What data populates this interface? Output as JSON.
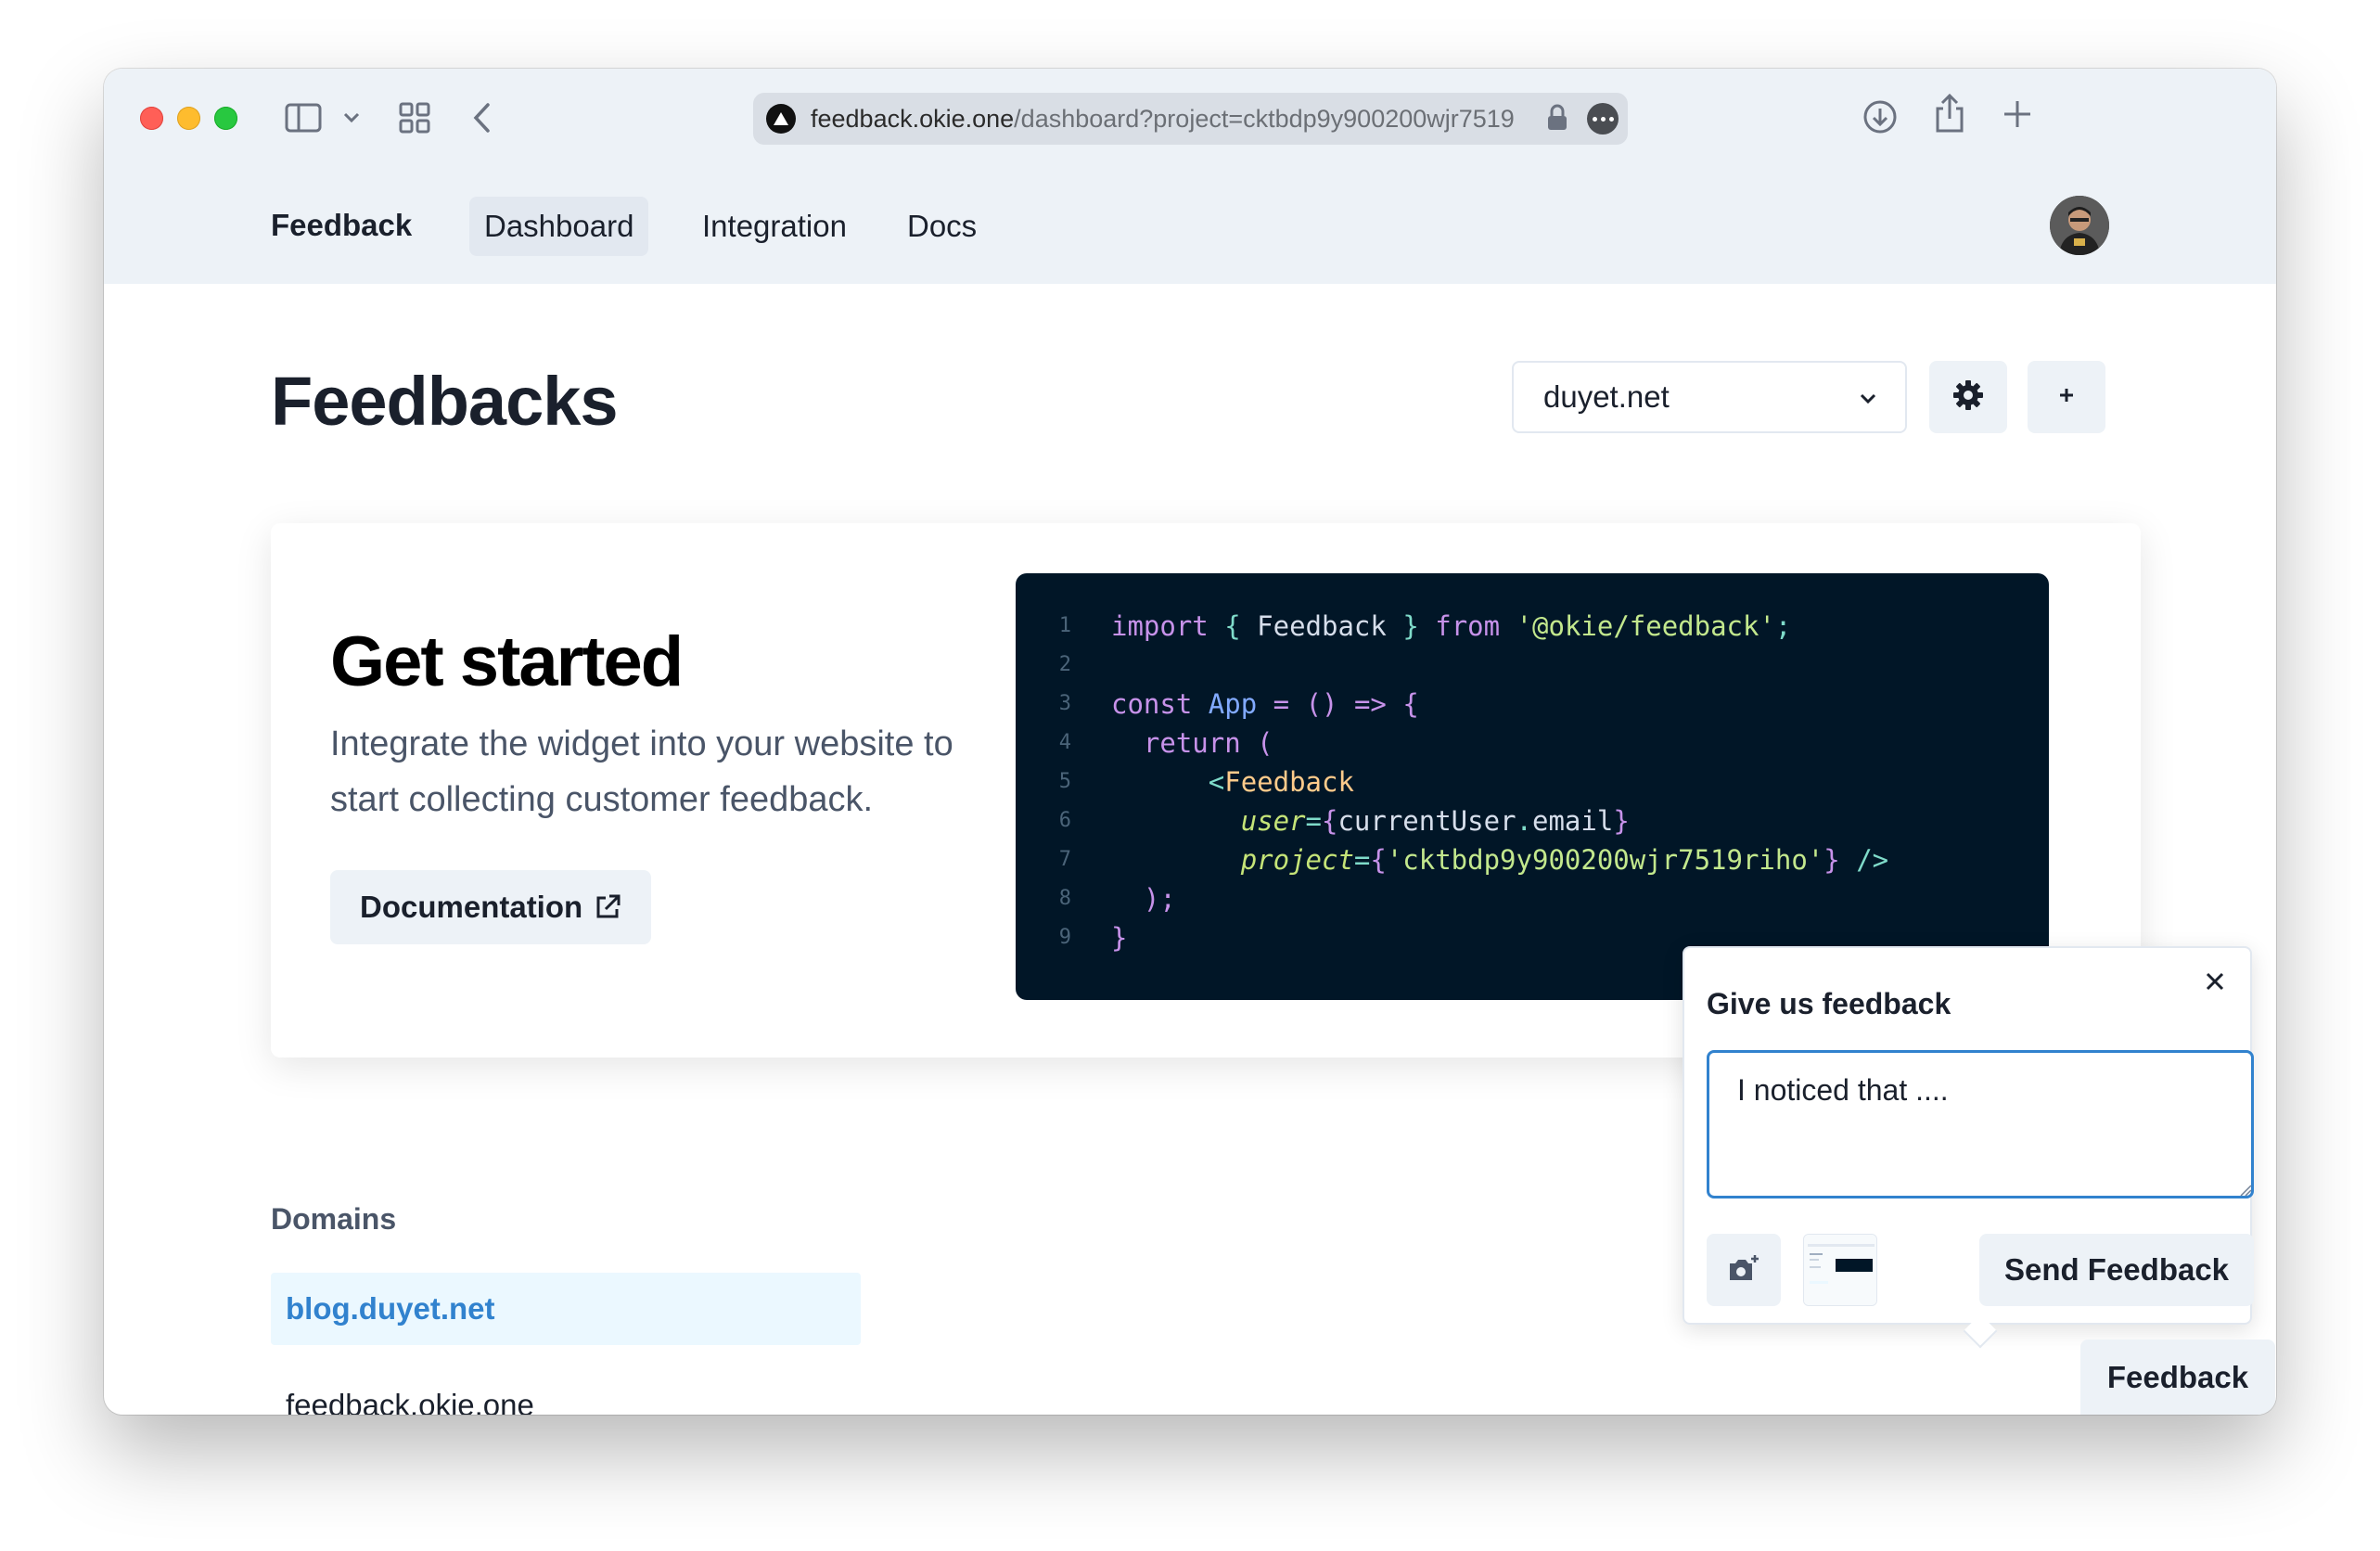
{
  "browser": {
    "url_domain": "feedback.okie.one",
    "url_path": "/dashboard?project=cktbdp9y900200wjr7519"
  },
  "nav": {
    "brand": "Feedback",
    "links": [
      "Dashboard",
      "Integration",
      "Docs"
    ],
    "active": "Dashboard"
  },
  "page": {
    "title": "Feedbacks",
    "project_select": "duyet.net"
  },
  "get_started": {
    "title": "Get started",
    "description": "Integrate the widget into your website to start collecting customer feedback.",
    "doc_button": "Documentation"
  },
  "code": {
    "line_numbers": [
      "1",
      "2",
      "3",
      "4",
      "5",
      "6",
      "7",
      "8",
      "9"
    ]
  },
  "domains": {
    "label": "Domains",
    "items": [
      "blog.duyet.net",
      "feedback.okie.one"
    ],
    "selected": "blog.duyet.net"
  },
  "feedback_widget": {
    "title": "Give us feedback",
    "textarea_value": "I noticed that ....",
    "send_button": "Send Feedback",
    "tab_label": "Feedback"
  },
  "colors": {
    "accent": "#3182ce",
    "code_bg": "#011627",
    "topbar_bg": "#edf2f7"
  }
}
